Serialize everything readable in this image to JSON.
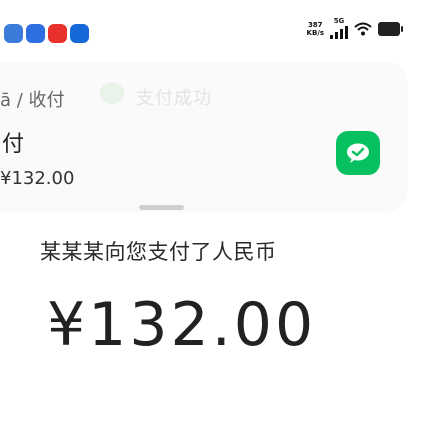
{
  "status_bar": {
    "net_speed_value": "387",
    "net_speed_unit": "KB/s",
    "network_type": "5G"
  },
  "card": {
    "breadcrumb": "ā / 收付",
    "success_text": "支付成功",
    "payee_name": "付",
    "amount": "¥132.00"
  },
  "announcement": {
    "text": "某某某向您支付了人民币",
    "amount": "¥132.00"
  },
  "colors": {
    "wechat_green": "#07c160",
    "card_bg": "#fafafa"
  }
}
